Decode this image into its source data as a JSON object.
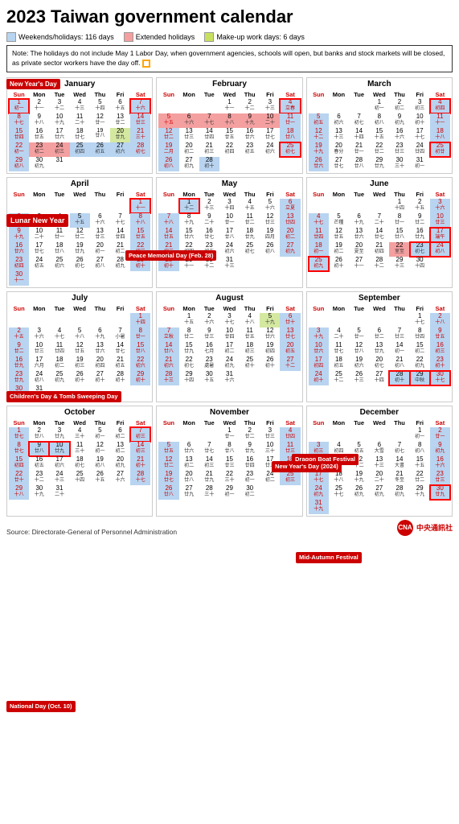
{
  "title": "2023 Taiwan government calendar",
  "legend": {
    "weekends": {
      "label": "Weekends/holidays: 116 days",
      "color": "#b8d4f0"
    },
    "extended": {
      "label": "Extended holidays",
      "color": "#f4a0a0"
    },
    "makeup": {
      "label": "Make-up work days: 6 days",
      "color": "#c8e060"
    }
  },
  "note": "Note: The holidays do not include May 1 Labor Day, when government agencies, schools will open, but banks and stock markets will be closed, as private sector workers have the day off.",
  "source": "Source: Directorate-General of Personnel Administration",
  "annotations": {
    "new_years_day": "New Year's Day",
    "lunar_new_year": "Lunar New Year",
    "peace_memorial": "Peace Memorial Day (Feb. 28)",
    "childrens_tomb": "Children's Day & Tomb Sweeping Day",
    "dragon_boat": "Dragon Boat Festival",
    "mid_autumn": "Mid-Autumn Festival",
    "national_day": "National Day (Oct. 10)",
    "new_years_2024": "New Year's Day (2024)"
  }
}
